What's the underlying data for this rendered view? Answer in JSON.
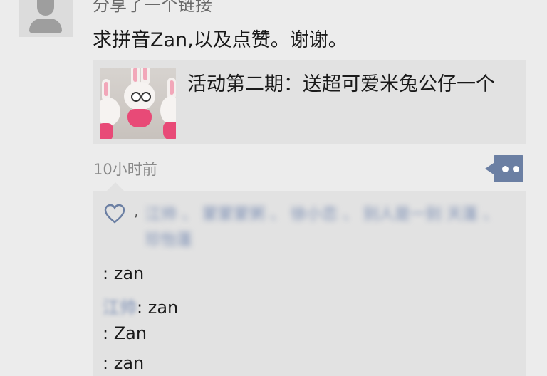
{
  "post": {
    "author_top_text": "分享了一个链接",
    "text": "求拼音Zan,以及点赞。谢谢。",
    "link_title": "活动第二期：送超可爱米兔公仔一个",
    "time": "10小时前"
  },
  "likes": {
    "separator": ",",
    "names_blurred": "江帅 、 蒙蒙蒙粥 、 徐小恋 、 别人是一别 天蓬 、 珍怡蓬"
  },
  "comments": [
    {
      "author": "",
      "text": ": zan"
    },
    {
      "author": "江帅",
      "text": ": zan"
    },
    {
      "author": "",
      "text": ": Zan"
    },
    {
      "author": "",
      "text": ": zan"
    }
  ],
  "colors": {
    "link_blue": "#7b8eb4",
    "comment_button": "#6b7fa3",
    "background": "#ececec",
    "card": "#e2e2e2"
  },
  "icons": {
    "avatar": "default-avatar-icon",
    "heart": "heart-outline-icon",
    "comment": "comment-bubble-icon"
  }
}
